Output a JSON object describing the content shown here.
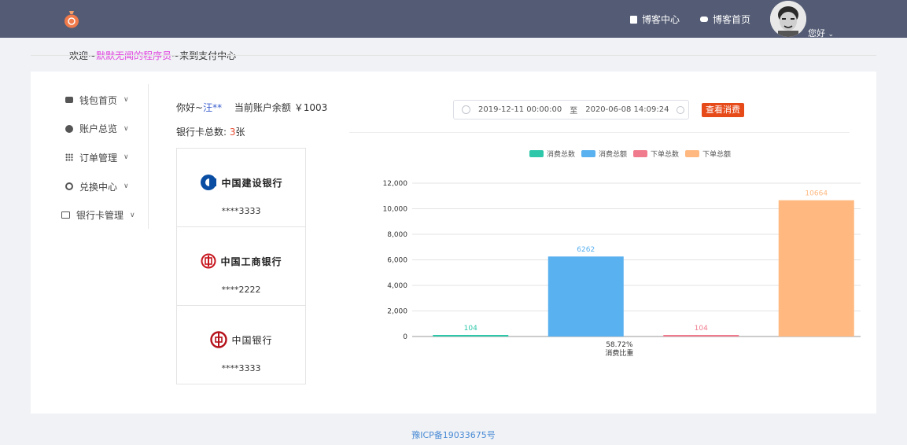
{
  "header": {
    "nav": [
      {
        "label": "博客中心",
        "icon": "bookmark-icon"
      },
      {
        "label": "博客首页",
        "icon": "robot-icon"
      }
    ],
    "greeting": "您好",
    "user_menu_icon": "chevron-down-icon"
  },
  "welcome": {
    "prefix": "欢迎~",
    "name": "默默无闻的程序员",
    "suffix": "~来到支付中心"
  },
  "sidebar": {
    "items": [
      {
        "label": "钱包首页",
        "icon": "wallet-icon"
      },
      {
        "label": "账户总览",
        "icon": "compass-icon"
      },
      {
        "label": "订单管理",
        "icon": "grid-icon"
      },
      {
        "label": "兑换中心",
        "icon": "exchange-icon"
      },
      {
        "label": "银行卡管理",
        "icon": "card-icon"
      }
    ]
  },
  "account": {
    "hello": "你好~",
    "user": "汪**",
    "balance_label": "当前账户余额",
    "balance": "￥1003",
    "card_count_label": "银行卡总数: ",
    "card_count": "3",
    "card_count_unit": "张"
  },
  "cards": [
    {
      "bank": "中国建设银行",
      "number": "****3333"
    },
    {
      "bank": "中国工商银行",
      "number": "****2222"
    },
    {
      "bank": "中国银行",
      "number": "****3333"
    }
  ],
  "filter": {
    "start": "2019-12-11 00:00:00",
    "to": "至",
    "end": "2020-06-08 14:09:24",
    "button": "查看消费"
  },
  "chart_data": {
    "type": "bar",
    "title": "",
    "ylim": [
      0,
      12000
    ],
    "yticks": [
      "0",
      "2,000",
      "4,000",
      "6,000",
      "8,000",
      "10,000",
      "12,000"
    ],
    "grid": true,
    "legend_position": "top",
    "series": [
      {
        "name": "消费总数",
        "value": 104,
        "color": "#2ec7a9"
      },
      {
        "name": "消费总额",
        "value": 6262,
        "color": "#5ab1ef"
      },
      {
        "name": "下单总数",
        "value": 104,
        "color": "#f07b8d"
      },
      {
        "name": "下单总额",
        "value": 10664,
        "color": "#ffb980"
      }
    ],
    "annotation": {
      "percent": "58.72%",
      "label": "消费比重"
    }
  },
  "footer": {
    "icp": "豫ICP备19033675号"
  },
  "colors": {
    "header_bg": "#545c75",
    "accent_button": "#e64a19",
    "highlight_name": "#e040e0"
  }
}
